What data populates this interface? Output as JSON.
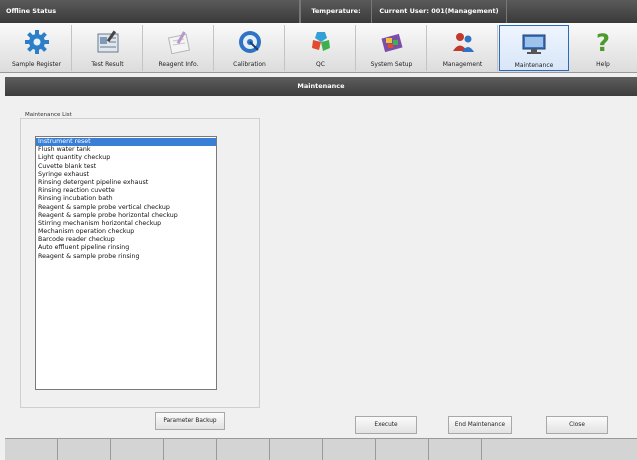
{
  "status": {
    "offline": "Offline Status",
    "temperature": "Temperature:",
    "user": "Current User: 001(Management)"
  },
  "toolbar": [
    {
      "label": "Sample Register",
      "icon": "gear-icon"
    },
    {
      "label": "Test Result",
      "icon": "test-result-icon"
    },
    {
      "label": "Reagent Info.",
      "icon": "reagent-icon"
    },
    {
      "label": "Calibration",
      "icon": "calibration-icon"
    },
    {
      "label": "QC",
      "icon": "qc-icon"
    },
    {
      "label": "System Setup",
      "icon": "system-setup-icon"
    },
    {
      "label": "Management",
      "icon": "management-icon"
    },
    {
      "label": "Maintenance",
      "icon": "maintenance-icon",
      "active": true
    },
    {
      "label": "Help",
      "icon": "help-icon"
    }
  ],
  "title": "Maintenance",
  "maintenance": {
    "list_label": "Maintenance List",
    "items": [
      "Instrument reset",
      "Flush water tank",
      "Light quantity checkup",
      "Cuvette blank test",
      "Syringe exhaust",
      "Rinsing detergent pipeline exhaust",
      "Rinsing reaction cuvette",
      "Rinsing incubation bath",
      "Reagent & sample probe vertical checkup",
      "Reagent & sample probe horizontal checkup",
      "Stirring mechanism horizontal checkup",
      "Mechanism operation checkup",
      "Barcode reader checkup",
      "Auto effluent pipeline rinsing",
      "Reagent & sample probe rinsing"
    ],
    "selected_index": 0
  },
  "buttons": {
    "parameter_backup": "Parameter Backup",
    "execute": "Execute",
    "end_maintenance": "End Maintenance",
    "close": "Close"
  },
  "colors": {
    "accent": "#2a6bbd",
    "selection": "#3a7fd6",
    "header_dark": "#3c3c3c"
  }
}
